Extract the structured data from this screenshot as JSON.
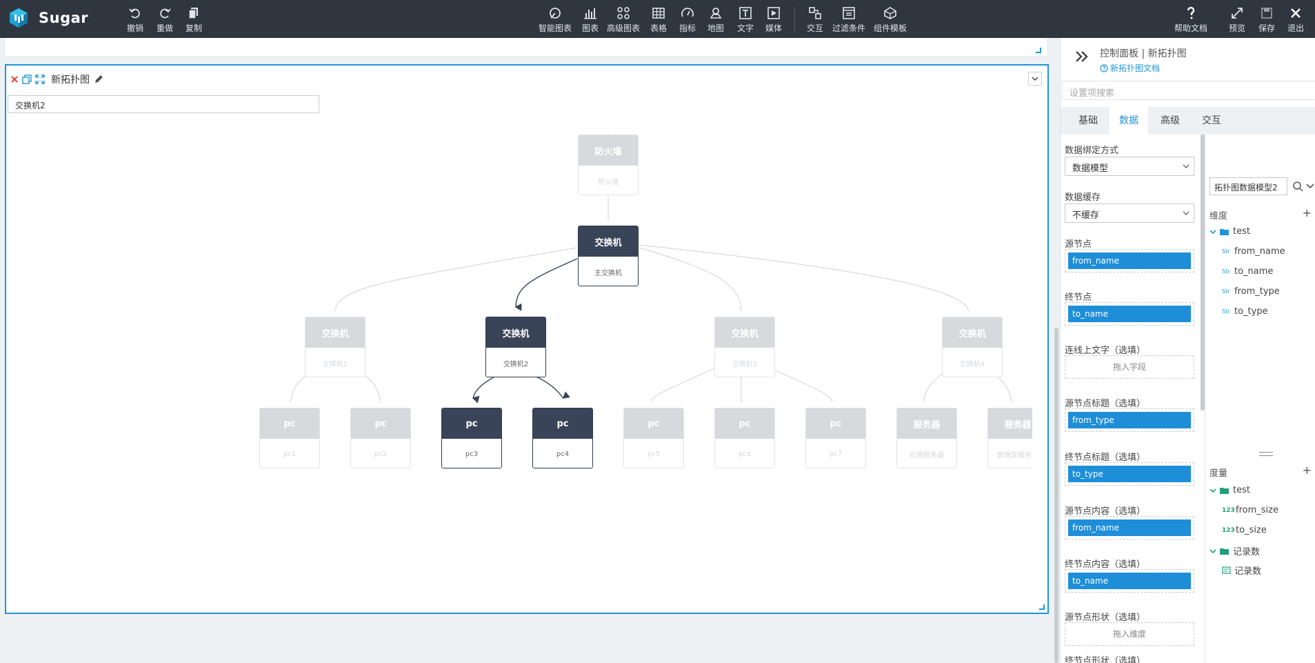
{
  "app": {
    "name": "Sugar"
  },
  "toolbar": {
    "undo": "撤销",
    "redo": "重做",
    "copy": "复制",
    "smart_chart": "智能图表",
    "chart": "图表",
    "advanced_chart": "高级图表",
    "table": "表格",
    "indicator": "指标",
    "map": "地图",
    "text": "文字",
    "media": "媒体",
    "interaction": "交互",
    "filter": "过滤条件",
    "component_template": "组件模板",
    "help_doc": "帮助文档",
    "preview": "预览",
    "save": "保存",
    "exit": "退出"
  },
  "widget": {
    "title": "新拓扑图",
    "filter_value": "交换机2"
  },
  "topology": {
    "nodes": [
      {
        "title": "防火墙",
        "label": "防火墙",
        "active": false
      },
      {
        "title": "交换机",
        "label": "主交换机",
        "active": true
      },
      {
        "title": "交换机",
        "label": "交换机1",
        "active": false
      },
      {
        "title": "交换机",
        "label": "交换机2",
        "active": true
      },
      {
        "title": "交换机",
        "label": "交换机3",
        "active": false
      },
      {
        "title": "交换机",
        "label": "交换机4",
        "active": false
      },
      {
        "title": "pc",
        "label": "pc1",
        "active": false
      },
      {
        "title": "pc",
        "label": "pc2",
        "active": false
      },
      {
        "title": "pc",
        "label": "pc3",
        "active": true
      },
      {
        "title": "pc",
        "label": "pc4",
        "active": true
      },
      {
        "title": "pc",
        "label": "pc5",
        "active": false
      },
      {
        "title": "pc",
        "label": "pc6",
        "active": false
      },
      {
        "title": "pc",
        "label": "pc7",
        "active": false
      },
      {
        "title": "服务器",
        "label": "应用服务器",
        "active": false
      },
      {
        "title": "服务器",
        "label": "数据库服务器",
        "active": false
      }
    ]
  },
  "panel": {
    "title": "控制面板 | 新拓扑图",
    "doc_link": "新拓扑图文档",
    "search_placeholder": "设置项搜索",
    "tabs": [
      "基础",
      "数据",
      "高级",
      "交互"
    ],
    "active_tab": "数据",
    "binding_label": "数据绑定方式",
    "binding_value": "数据模型",
    "cache_label": "数据缓存",
    "cache_value": "不缓存",
    "source_label": "源节点",
    "source_value": "from_name",
    "target_label": "终节点",
    "target_value": "to_name",
    "edge_text_label": "连线上文字（选填）",
    "edge_text_ph": "拖入字段",
    "src_title_label": "源节点标题（选填）",
    "src_title_value": "from_type",
    "tgt_title_label": "终节点标题（选填）",
    "tgt_title_value": "to_type",
    "src_content_label": "源节点内容（选填）",
    "src_content_value": "from_name",
    "tgt_content_label": "终节点内容（选填）",
    "tgt_content_value": "to_name",
    "src_shape_label": "源节点形状（选填）",
    "src_shape_ph": "拖入维度",
    "tgt_shape_label": "终节点形状（选填）"
  },
  "model": {
    "select_value": "拓扑图数据模型2",
    "dimensions_label": "维度",
    "dim_folder": "test",
    "dimensions": [
      "from_name",
      "to_name",
      "from_type",
      "to_type"
    ],
    "dim_tag": "Str",
    "measures_label": "度量",
    "measure_folder": "test",
    "measures": [
      "from_size",
      "to_size"
    ],
    "measure_tag": "123",
    "count_folder": "记录数",
    "count_item": "记录数"
  },
  "colors": {
    "accent": "#1f95d8",
    "topbar": "#2f3640",
    "active_node": "#3a4458"
  }
}
